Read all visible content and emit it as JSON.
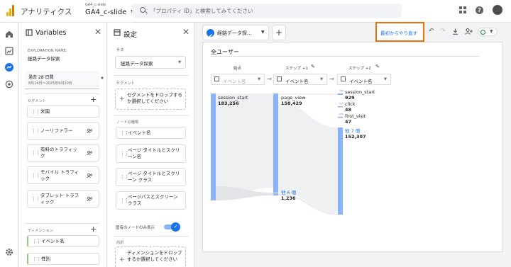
{
  "header": {
    "app_title": "アナリティクス",
    "account_small": "GA4_c-slide",
    "account_name": "GA4_c-slide",
    "search_placeholder": "「プロパティ ID」と検索してみてください"
  },
  "variables_panel": {
    "title": "Variables",
    "exploration_name_label": "EXPLORATION NAME:",
    "exploration_name": "経路データ探索",
    "date_label": "過去 28 日間",
    "date_range": "8月14日～2025年9月10日",
    "segments_label": "セグメント",
    "segments": [
      "米国",
      "ノーリファラー",
      "有料のトラフィック",
      "モバイル トラフィック",
      "タブレット トラフィック"
    ],
    "dimensions_label": "ディメンション",
    "dimensions": [
      "イベント名",
      "性別"
    ]
  },
  "settings_panel": {
    "title": "設定",
    "technique_label": "手法",
    "technique_value": "経路データ探索",
    "segment_label": "セグメント",
    "segment_drop": "セグメントをドロップするか選択してください",
    "node_type_label": "ノードの種類",
    "node_types": [
      "イベント名",
      "ページ タイトルとスクリーン名",
      "ページ タイトルとスクリーン クラス",
      "ページパスとスクリーン クラス"
    ],
    "unique_nodes_label": "固有のノードのみ表示",
    "breakdown_label": "内訳",
    "breakdown_drop": "ディメンションをドロップするか選択してください"
  },
  "tab": {
    "label": "経路データ探...",
    "add_label": "+"
  },
  "toolbar": {
    "restart_label": "最初からやり直す"
  },
  "canvas": {
    "segment": "全ユーザー",
    "columns": [
      {
        "header": "始点",
        "select": "イベント名",
        "placeholder": true
      },
      {
        "header": "ステップ +1",
        "select": "イベント名",
        "placeholder": false
      },
      {
        "header": "ステップ +2",
        "select": "イベント名",
        "placeholder": false
      }
    ],
    "start_node": {
      "name": "session_start",
      "value": "183,256"
    },
    "step1_nodes": [
      {
        "name": "page_view",
        "value": "158,429"
      },
      {
        "name": "他 6 個",
        "value": "1,236"
      }
    ],
    "step2_nodes": [
      {
        "name": "session_start",
        "value": "929"
      },
      {
        "name": "click",
        "value": "48"
      },
      {
        "name": "first_visit",
        "value": "47"
      },
      {
        "name": "他 7 個",
        "value": "152,307"
      }
    ]
  },
  "colors": {
    "accent": "#1a73e8",
    "node": "#8ab4f8",
    "flow": "#e8eaed",
    "highlight": "#e8710a"
  }
}
